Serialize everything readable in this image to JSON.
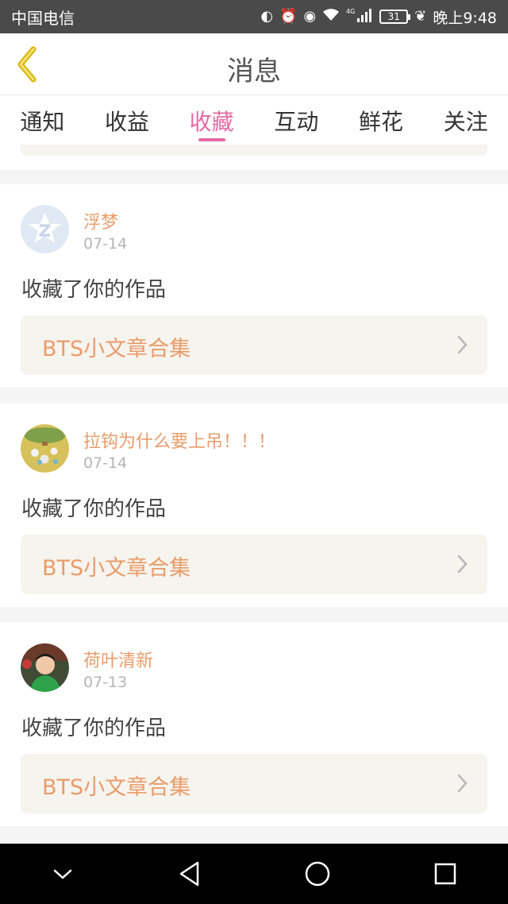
{
  "status_bar": {
    "carrier": "中国电信",
    "network": "4G",
    "battery": "31",
    "time": "晚上9:48"
  },
  "header": {
    "title": "消息",
    "back_icon": "chevron-left-icon"
  },
  "tabs": [
    {
      "label": "通知",
      "active": false
    },
    {
      "label": "收益",
      "active": false
    },
    {
      "label": "收藏",
      "active": true
    },
    {
      "label": "互动",
      "active": false
    },
    {
      "label": "鲜花",
      "active": false
    },
    {
      "label": "关注",
      "active": false
    }
  ],
  "colors": {
    "accent_pink": "#e56aa5",
    "name_orange": "#e99c6a",
    "work_bg": "#f6f4ee"
  },
  "messages": [
    {
      "name": "浮梦",
      "date": "07-14",
      "action": "收藏了你的作品",
      "work": "BTS小文章合集",
      "avatar": "default-avatar"
    },
    {
      "name": "拉钩为什么要上吊！！！",
      "date": "07-14",
      "action": "收藏了你的作品",
      "work": "BTS小文章合集",
      "avatar": "game-avatar"
    },
    {
      "name": "荷叶清新",
      "date": "07-13",
      "action": "收藏了你的作品",
      "work": "BTS小文章合集",
      "avatar": "child-photo-avatar"
    }
  ]
}
